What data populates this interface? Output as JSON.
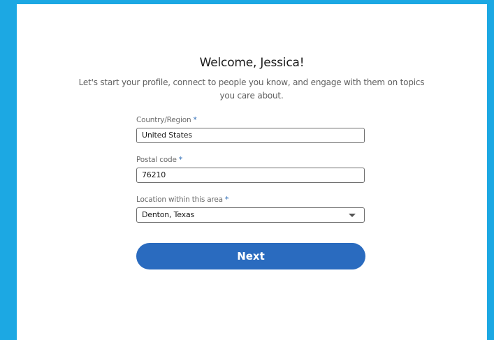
{
  "heading": "Welcome, Jessica!",
  "subheading": "Let's start your profile, connect to people you know, and engage with them on topics you care about.",
  "form": {
    "country": {
      "label": "Country/Region",
      "required_mark": "*",
      "value": "United States"
    },
    "postal": {
      "label": "Postal code",
      "required_mark": "*",
      "value": "76210"
    },
    "location": {
      "label": "Location within this area",
      "required_mark": "*",
      "value": "Denton, Texas"
    }
  },
  "next_label": "Next",
  "colors": {
    "page_background": "#1ca8e3",
    "card_background": "#ffffff",
    "primary_button": "#2a6bbf",
    "required_asterisk": "#2a6ab5"
  }
}
